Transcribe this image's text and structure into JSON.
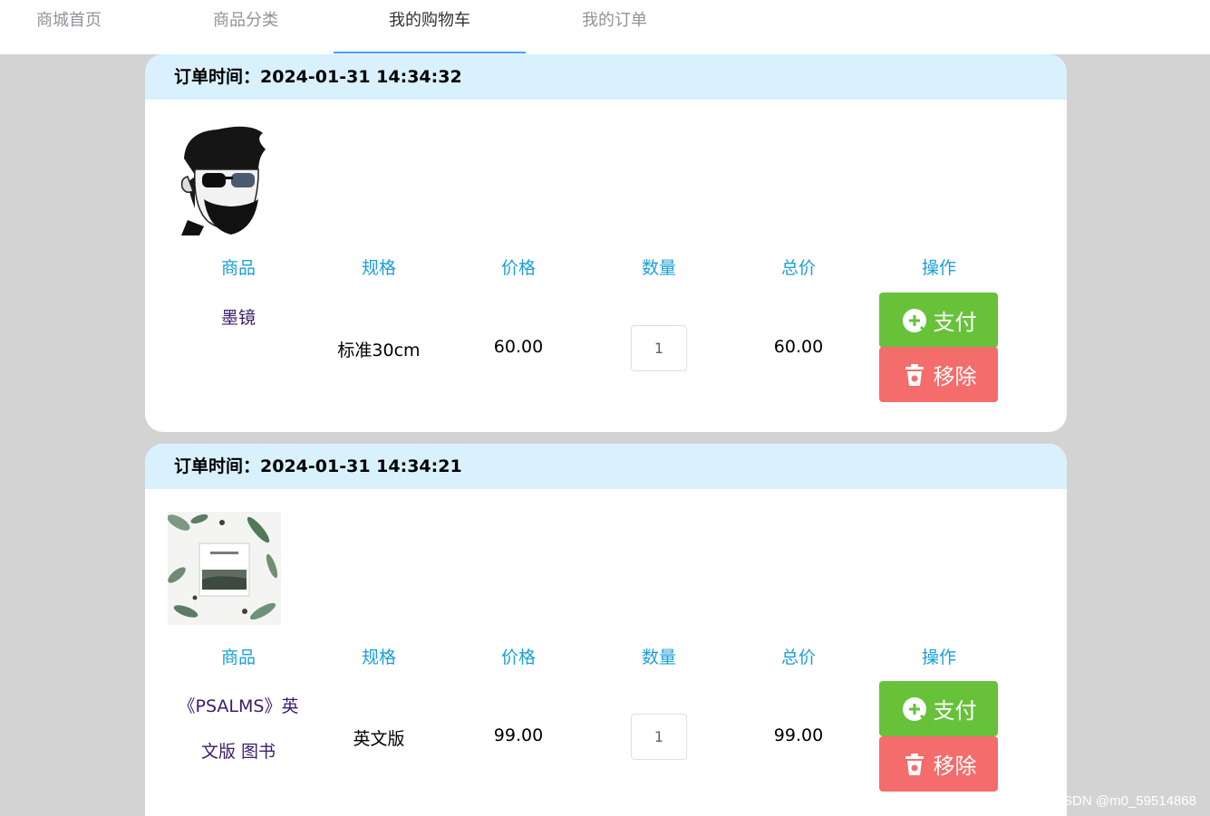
{
  "nav": {
    "tabs": [
      {
        "label": "商城首页",
        "active": false
      },
      {
        "label": "商品分类",
        "active": false
      },
      {
        "label": "我的购物车",
        "active": true
      },
      {
        "label": "我的订单",
        "active": false
      }
    ]
  },
  "columns": [
    "商品",
    "规格",
    "价格",
    "数量",
    "总价",
    "操作"
  ],
  "orders": [
    {
      "time_label": "订单时间：",
      "time_value": "2024-01-31 14:34:32",
      "product_lines": [
        "墨镜"
      ],
      "spec": "标准30cm",
      "price": "60.00",
      "quantity": "1",
      "total": "60.00",
      "image_icon": "bearded-man-sunglasses-image"
    },
    {
      "time_label": "订单时间：",
      "time_value": "2024-01-31 14:34:21",
      "product_lines": [
        "《PSALMS》英",
        "文版 图书"
      ],
      "spec": "英文版",
      "price": "99.00",
      "quantity": "1",
      "total": "99.00",
      "image_icon": "psalms-book-image"
    }
  ],
  "actions": {
    "pay_label": "支付",
    "remove_label": "移除"
  },
  "colors": {
    "accent": "#409eff",
    "header_bg": "#d9f1fd",
    "column_text": "#1a9fd8",
    "pay": "#67c23a",
    "remove": "#f56c6c"
  },
  "watermark": "CSDN @m0_59514868"
}
